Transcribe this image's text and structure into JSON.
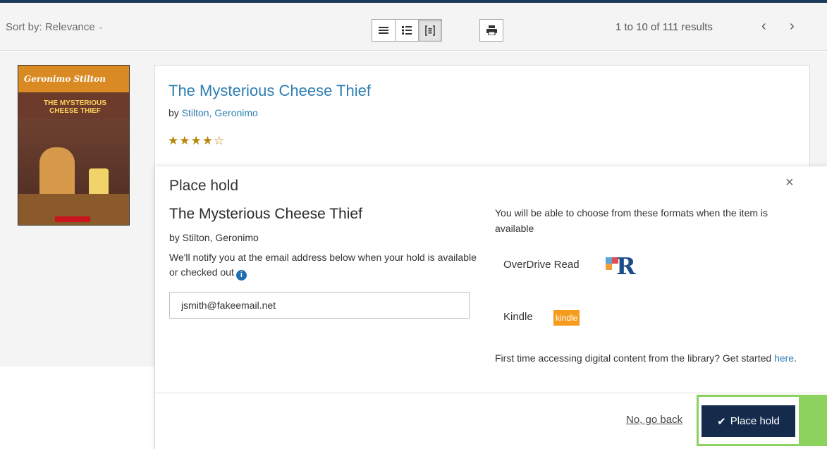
{
  "toolbar": {
    "sort_label": "Sort by: Relevance",
    "sort_chevron": "⌄",
    "view_buttons": [
      {
        "icon": "list-view-icon",
        "active": false
      },
      {
        "icon": "detailed-list-icon",
        "active": false
      },
      {
        "icon": "card-view-icon",
        "active": true
      }
    ],
    "print_icon": "print-icon",
    "results_count": "1 to 10 of 111 results",
    "prev_glyph": "‹",
    "next_glyph": "›"
  },
  "result": {
    "title": "The Mysterious Cheese Thief",
    "by_prefix": "by",
    "author": "Stilton, Geronimo",
    "stars": "★★★★☆",
    "rating": 4,
    "rating_max": 5,
    "cover": {
      "brand": "Geronimo Stilton",
      "title_line1": "THE MYSTERIOUS",
      "title_line2": "CHEESE THIEF"
    }
  },
  "modal": {
    "heading": "Place hold",
    "close_glyph": "×",
    "item_title": "The Mysterious Cheese Thief",
    "item_by": "by Stilton, Geronimo",
    "notify_text": "We'll notify you at the email address below when your hold is available or checked out",
    "info_glyph": "i",
    "email_value": "jsmith@fakeemail.net",
    "formats_note": "You will be able to choose from these formats when the item is available",
    "formats": [
      {
        "label": "OverDrive Read",
        "logo": "overdrive-read-logo"
      },
      {
        "label": "Kindle",
        "logo": "kindle-logo",
        "logo_text": "kindle"
      }
    ],
    "first_time_text": "First time accessing digital content from the library? Get started",
    "first_time_link": "here",
    "first_time_suffix": ".",
    "cancel_label": "No, go back",
    "confirm_label": "Place hold",
    "confirm_icon": "✔"
  },
  "colors": {
    "link": "#2e7eb3",
    "primary_button": "#142b4c",
    "highlight": "#8dd15e",
    "kindle": "#f59c1f",
    "star": "#b8860b"
  }
}
